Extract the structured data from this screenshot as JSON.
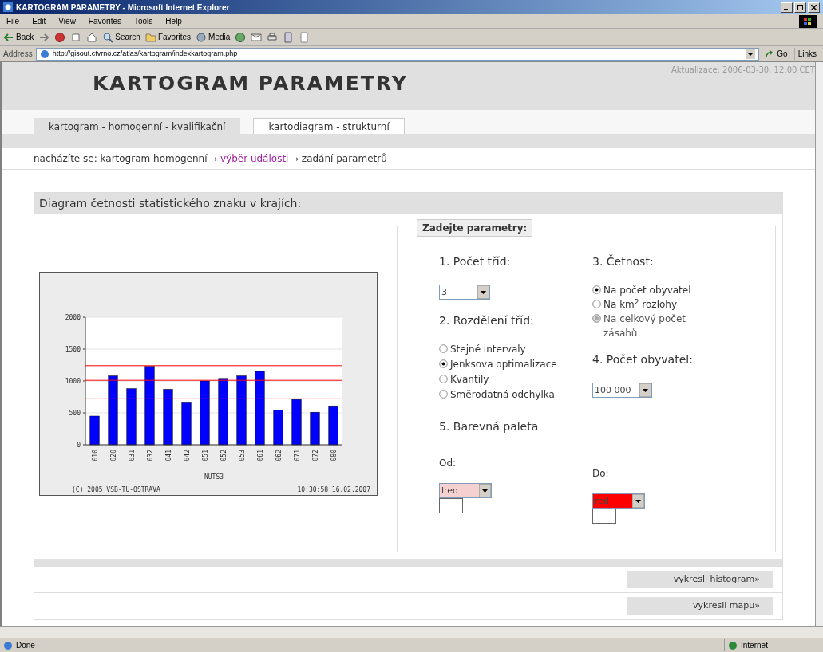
{
  "window": {
    "title": "KARTOGRAM PARAMETRY - Microsoft Internet Explorer"
  },
  "menu": [
    "File",
    "Edit",
    "View",
    "Favorites",
    "Tools",
    "Help"
  ],
  "toolbar": [
    {
      "kind": "back",
      "label": "Back"
    },
    {
      "kind": "forward"
    },
    {
      "kind": "stop"
    },
    {
      "kind": "refresh"
    },
    {
      "kind": "home"
    },
    {
      "kind": "search",
      "label": "Search"
    },
    {
      "kind": "favorites",
      "label": "Favorites"
    },
    {
      "kind": "media",
      "label": "Media"
    },
    {
      "kind": "history"
    },
    {
      "kind": "mail"
    },
    {
      "kind": "print"
    },
    {
      "kind": "edit"
    },
    {
      "kind": "discuss"
    }
  ],
  "address": {
    "label": "Address",
    "url": "http://gisout.ctvrno.cz/atlas/kartogram/indexkartogram.php",
    "go": "Go",
    "links": "Links"
  },
  "page": {
    "title": "KARTOGRAM PARAMETRY",
    "updated": "Aktualizace: 2006-03-30, 12:00 CET",
    "tabs": [
      {
        "label": "kartogram - homogenní - kvalifikační",
        "selected": true
      },
      {
        "label": "kartodiagram - strukturní",
        "selected": false
      }
    ],
    "breadcrumb": [
      {
        "kind": "text",
        "text": "nacházíte se: kartogram homogenní"
      },
      {
        "kind": "arrow",
        "text": "→"
      },
      {
        "kind": "link",
        "text": "výběr události"
      },
      {
        "kind": "arrow",
        "text": "→"
      },
      {
        "kind": "text",
        "text": "zadání parametrů"
      }
    ],
    "panel_title": "Diagram četnosti statistického znaku v krajích:",
    "chart_data": {
      "type": "bar",
      "xlabel": "NUTS3",
      "categories": [
        "010",
        "020",
        "031",
        "032",
        "041",
        "042",
        "051",
        "052",
        "053",
        "061",
        "062",
        "071",
        "072",
        "080"
      ],
      "series": [
        {
          "color": "#0000ff",
          "values": [
            450,
            1080,
            880,
            1230,
            870,
            670,
            1000,
            1040,
            1080,
            1150,
            540,
            710,
            510,
            610
          ]
        }
      ],
      "ylim": [
        0,
        2000
      ],
      "yticks": [
        0,
        500,
        1000,
        1500,
        2000
      ],
      "grid": true,
      "ref_lines": [
        {
          "value": 1240,
          "axis": "y",
          "color": "#ff0000"
        },
        {
          "value": 1010,
          "axis": "y",
          "color": "#ff0000"
        },
        {
          "value": 720,
          "axis": "y",
          "color": "#ff0000"
        }
      ]
    },
    "chart_footer": {
      "copyright": "(C) 2005 VSB-TU-OSTRAVA",
      "timestamp": "10:30:58 16.02.2007"
    },
    "form": {
      "legend": "Zadejte parametry:",
      "classes": {
        "label": "1. Počet tříd:",
        "value": "3"
      },
      "division": {
        "label": "2. Rozdělení tříd:",
        "options": [
          {
            "label": "Stejné intervaly",
            "checked": false
          },
          {
            "label": "Jenksova optimalizace",
            "checked": true
          },
          {
            "label": "Kvantily",
            "checked": false
          },
          {
            "label": "Směrodatná odchylka",
            "checked": false
          }
        ]
      },
      "frequency": {
        "label": "3. Četnost:",
        "options": [
          {
            "label": "Na počet obyvatel",
            "checked": true,
            "disabled": false
          },
          {
            "label": "Na km$^{2}$ rozlohy",
            "checked": false,
            "disabled": false
          },
          {
            "label": "Na celkový počet zásahů",
            "checked": false,
            "disabled": true
          }
        ]
      },
      "population": {
        "label": "4. Počet obyvatel:",
        "value": "100 000"
      },
      "palette": {
        "label": "5. Barevná paleta",
        "from": {
          "label": "Od:",
          "value": "lred",
          "color": "#f5d0d0"
        },
        "to": {
          "label": "Do:",
          "value": "red",
          "color": "#ff0000"
        }
      }
    },
    "buttons": [
      "vykresli histogram»",
      "vykresli mapu»"
    ]
  },
  "status_bar": {
    "text": "Done",
    "zone": "Internet"
  }
}
